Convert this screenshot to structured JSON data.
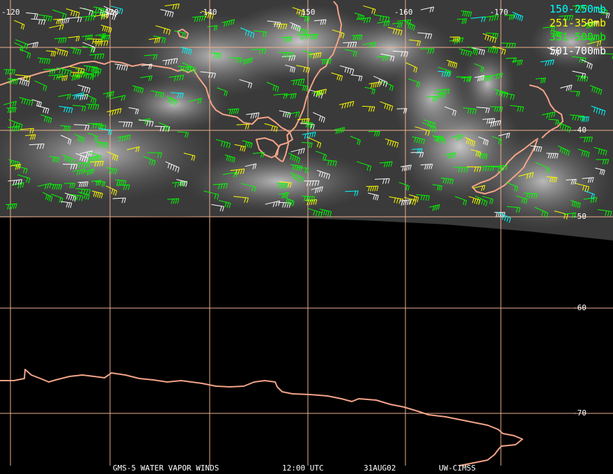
{
  "map": {
    "lon_labels": [
      "-120",
      "-130",
      "-140",
      "-150",
      "-160",
      "-170"
    ],
    "lat_labels": [
      "-40",
      "-50",
      "-60",
      "-70"
    ],
    "colors": {
      "background": "#000000",
      "grid": "#f0b090",
      "coastline": "#f4a488",
      "cloud": "#a0a0a0"
    }
  },
  "legend": {
    "items": [
      {
        "label": "150-250mb",
        "color": "#00ffff"
      },
      {
        "label": "251-350mb",
        "color": "#ffff00"
      },
      {
        "label": "351-500mb",
        "color": "#00ff00"
      },
      {
        "label": "501-700mb",
        "color": "#ffffff"
      }
    ]
  },
  "footer": {
    "satellite": "GMS-5 WATER VAPOR WINDS",
    "time": "12:00 UTC",
    "date": "31AUG02",
    "source": "UW-CIMSS"
  }
}
